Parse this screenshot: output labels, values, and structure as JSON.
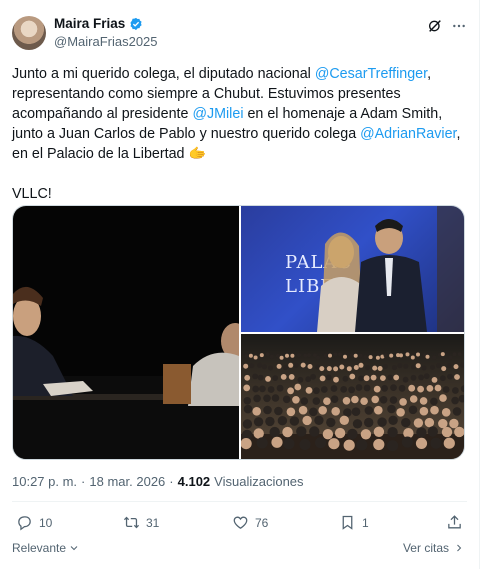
{
  "author": {
    "name": "Maira Frias",
    "handle": "@MairaFrias2025"
  },
  "tweet": {
    "p1": "Junto a mi querido colega, el diputado nacional ",
    "m1": "@CesarTreffinger",
    "p2": ", representando como siempre a Chubut. Estuvimos presentes acompañando al presidente ",
    "m2": "@JMilei",
    "p3": " en el homenaje a Adam Smith, junto a Juan Carlos de Pablo y nuestro querido colega ",
    "m3": "@AdrianRavier",
    "p4": ", en el Palacio de la Libertad 🫱",
    "p5": "\n\nVLLC!"
  },
  "media": {
    "sign_text": "PALACIO\nLIBERTAD"
  },
  "meta": {
    "time": "10:27 p. m.",
    "sep": "·",
    "date": "18 mar. 2026",
    "sep2": "·",
    "views_count": "4.102",
    "views_label": "Visualizaciones"
  },
  "actions": {
    "replies": "10",
    "reposts": "31",
    "likes": "76",
    "bookmarks": "1"
  },
  "footer": {
    "sort_label": "Relevante",
    "quotes_label": "Ver citas"
  },
  "colors": {
    "accent": "#1d9bf0",
    "secondary_text": "#536471",
    "divider": "#eff3f4"
  }
}
